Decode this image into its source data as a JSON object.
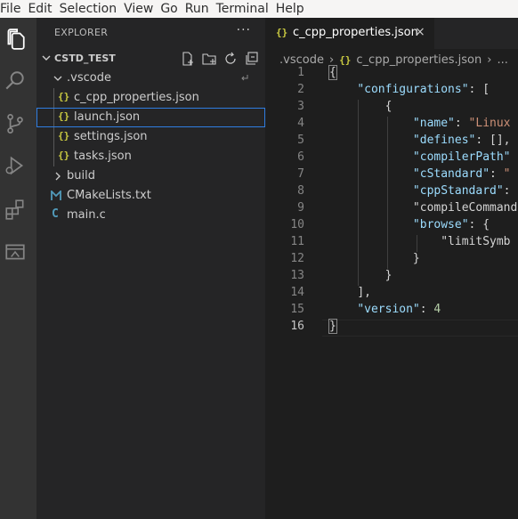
{
  "menu": [
    "File",
    "Edit",
    "Selection",
    "View",
    "Go",
    "Run",
    "Terminal",
    "Help"
  ],
  "activity_bar": [
    "explorer-icon",
    "search-icon",
    "source-control-icon",
    "run-debug-icon",
    "extensions-icon",
    "remote-explorer-icon"
  ],
  "sidebar": {
    "title": "EXPLORER",
    "more": "···",
    "project": "CSTD_TEST",
    "actions": [
      "new-file-icon",
      "new-folder-icon",
      "refresh-icon",
      "collapse-all-icon"
    ],
    "tree": [
      {
        "label": ".vscode",
        "type": "folder",
        "expanded": true
      },
      {
        "label": "c_cpp_properties.json",
        "type": "json",
        "icon": "{}"
      },
      {
        "label": "launch.json",
        "type": "json",
        "icon": "{}",
        "selected": true
      },
      {
        "label": "settings.json",
        "type": "json",
        "icon": "{}"
      },
      {
        "label": "tasks.json",
        "type": "json",
        "icon": "{}"
      },
      {
        "label": "build",
        "type": "folder",
        "expanded": false
      },
      {
        "label": "CMakeLists.txt",
        "type": "cmake",
        "icon": "M"
      },
      {
        "label": "main.c",
        "type": "c",
        "icon": "C"
      }
    ]
  },
  "editor": {
    "tab": {
      "icon": "{}",
      "label": "c_cpp_properties.json",
      "close": "×"
    },
    "breadcrumb": [
      ".vscode",
      "›",
      "{}",
      "c_cpp_properties.json",
      "›",
      "..."
    ],
    "lines": [
      {
        "num": "1",
        "text": "{"
      },
      {
        "num": "2",
        "text": "    \"configurations\": ["
      },
      {
        "num": "3",
        "text": "        {"
      },
      {
        "num": "4",
        "text": "            \"name\": \"Linux"
      },
      {
        "num": "5",
        "text": "            \"defines\": [],"
      },
      {
        "num": "6",
        "text": "            \"compilerPath\""
      },
      {
        "num": "7",
        "text": "            \"cStandard\": \""
      },
      {
        "num": "8",
        "text": "            \"cppStandard\":"
      },
      {
        "num": "9",
        "text": "            \"compileCommand"
      },
      {
        "num": "10",
        "text": "            \"browse\": {"
      },
      {
        "num": "11",
        "text": "                \"limitSymb"
      },
      {
        "num": "12",
        "text": "            }"
      },
      {
        "num": "13",
        "text": "        }"
      },
      {
        "num": "14",
        "text": "    ],"
      },
      {
        "num": "15",
        "text": "    \"version\": 4"
      },
      {
        "num": "16",
        "text": "}"
      }
    ],
    "active_line": "16"
  },
  "colors": {
    "json_icon": "#cbcb41",
    "c_icon": "#519aba",
    "key": "#9cdcfe",
    "string": "#ce9178",
    "number": "#b5cea8",
    "selection_border": "#2f7de1"
  }
}
